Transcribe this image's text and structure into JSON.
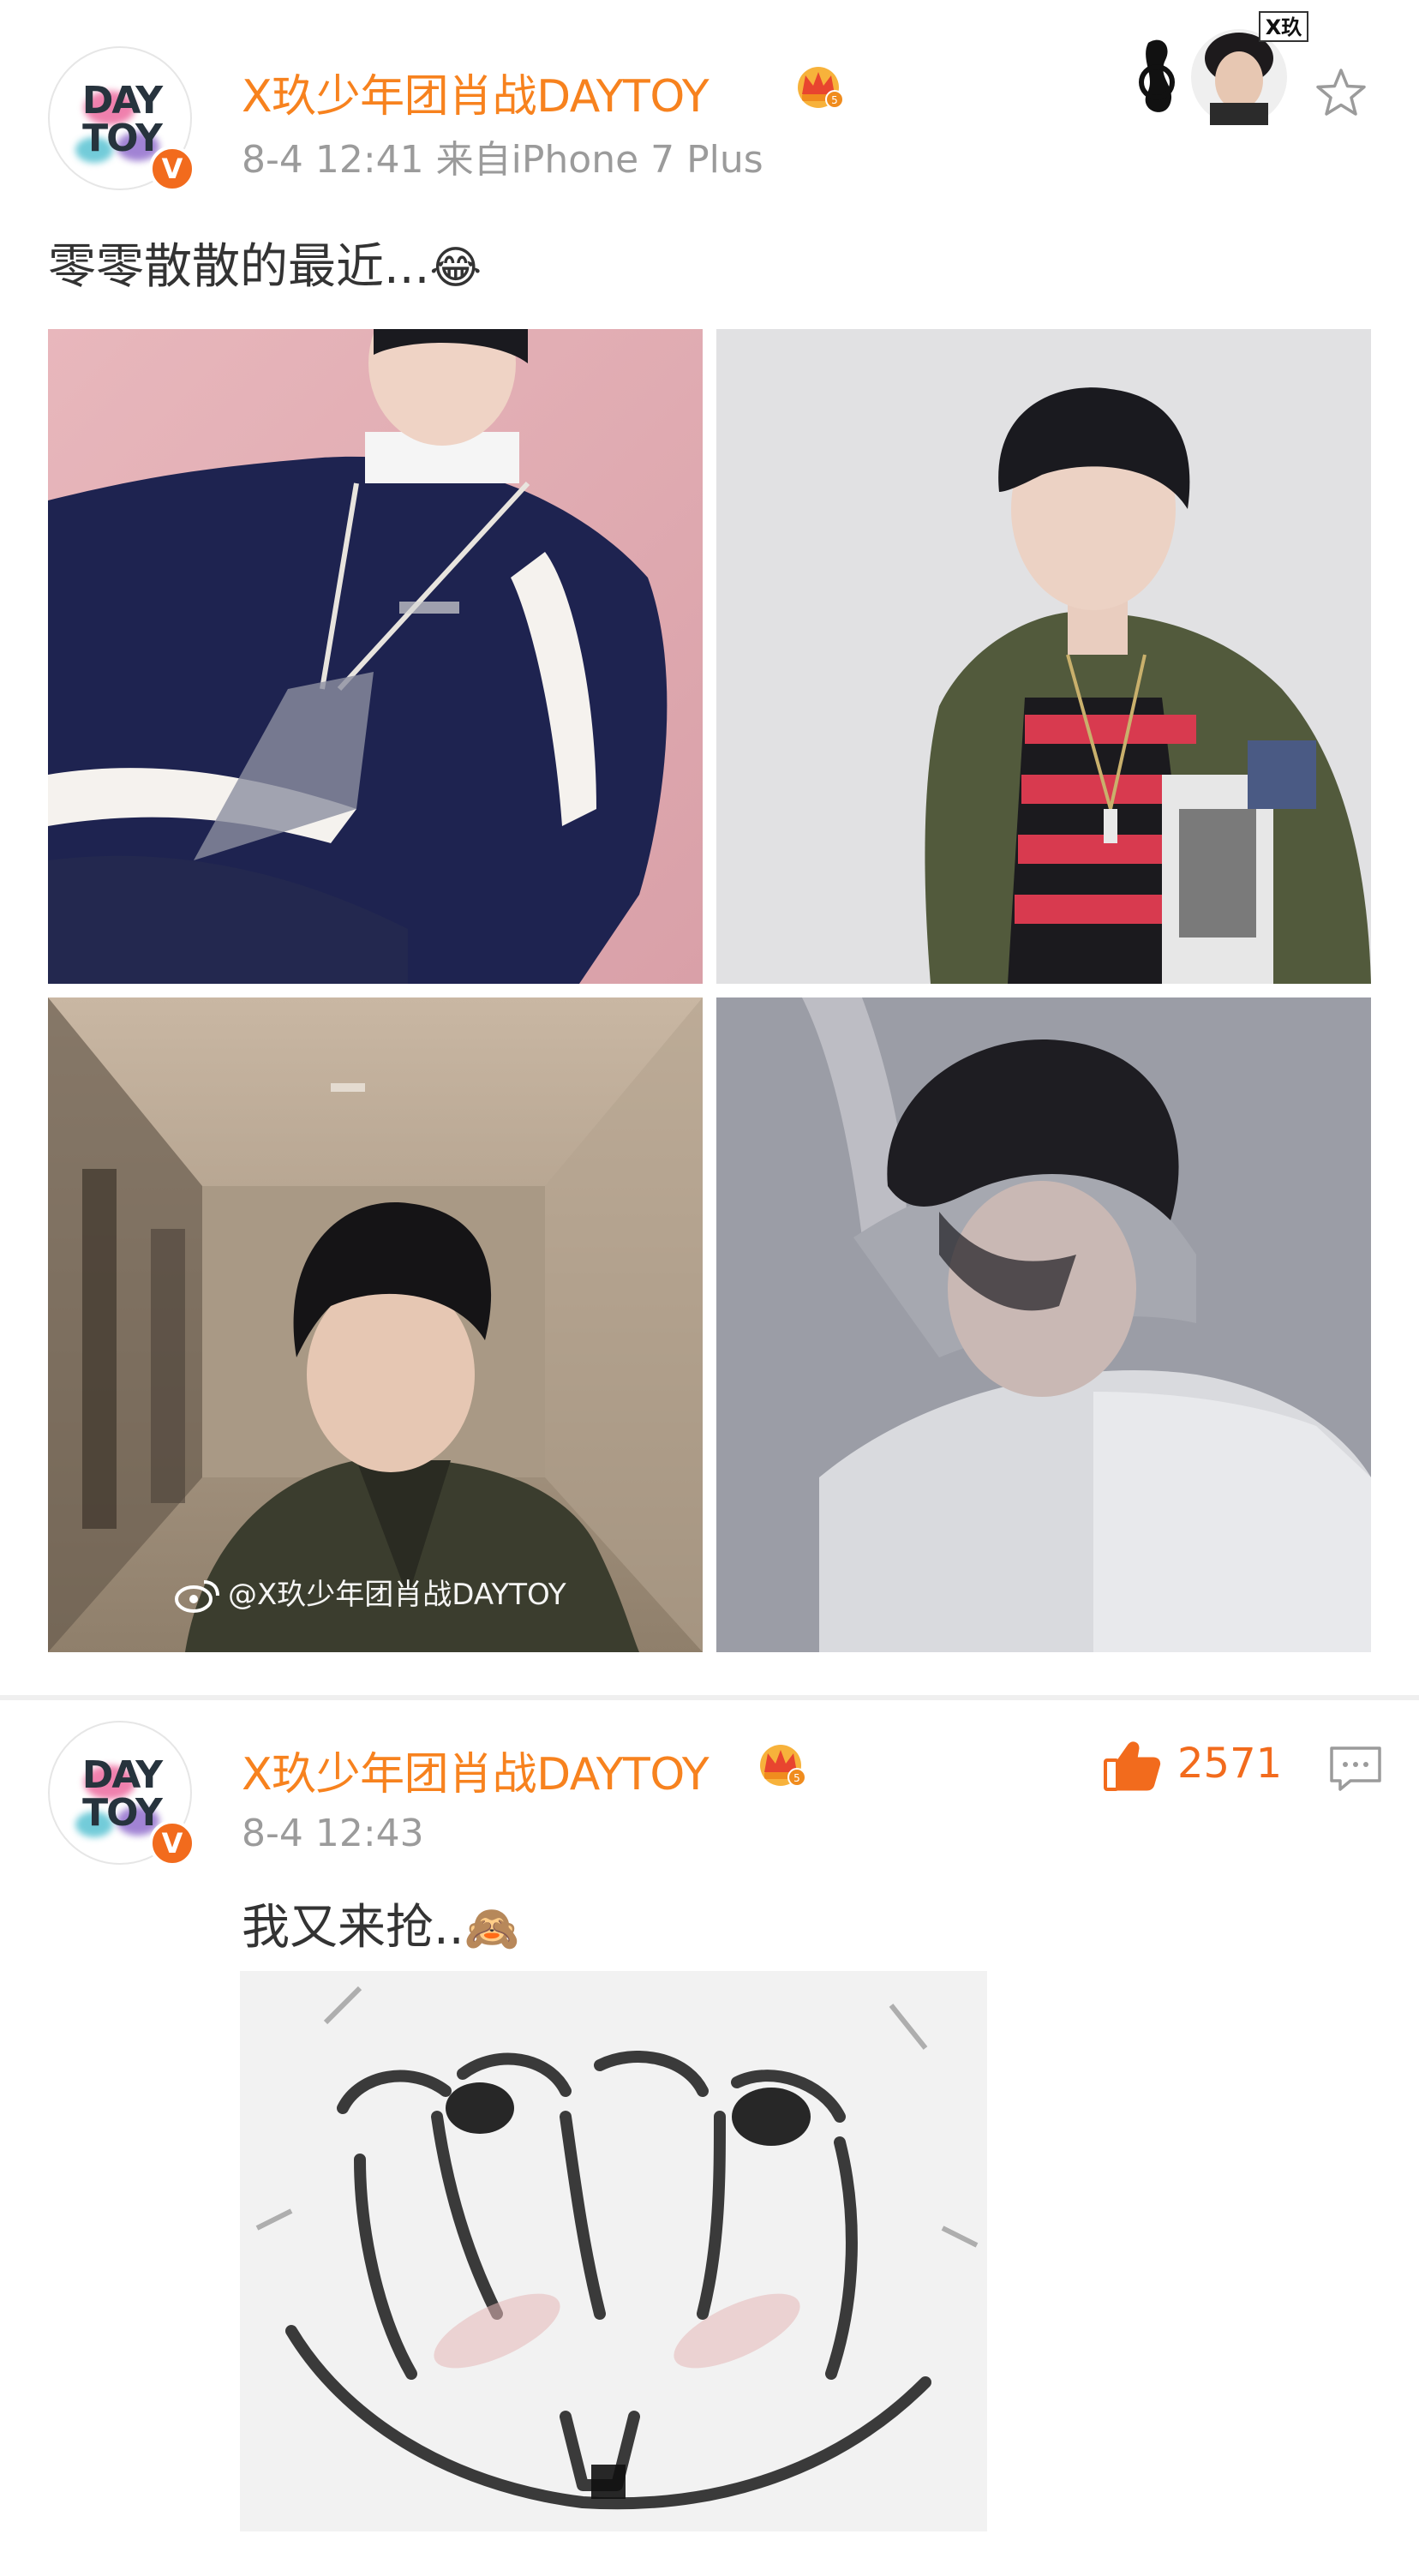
{
  "post": {
    "avatar": {
      "line1": "DAY",
      "line2": "TOY",
      "badge": "V"
    },
    "username": "X玖少年团肖战DAYTOY",
    "meta": "8-4 12:41  来自iPhone 7 Plus",
    "text": "零零散散的最近...",
    "text_emoji": "😂",
    "card_badge": "X玖",
    "photos": [
      {
        "name": "photo-navy-sweater"
      },
      {
        "name": "photo-olive-jacket-striped-shirt"
      },
      {
        "name": "photo-hallway-olive-jacket"
      },
      {
        "name": "photo-sleeping-white-shirt"
      }
    ],
    "watermark": "@X玖少年团肖战DAYTOY"
  },
  "comment": {
    "avatar": {
      "line1": "DAY",
      "line2": "TOY",
      "badge": "V"
    },
    "username": "X玖少年团肖战DAYTOY",
    "meta": "8-4 12:43",
    "text": "我又来抢..",
    "text_emoji": "🙈",
    "likes": "2571"
  },
  "colors": {
    "username": "#f7821e",
    "meta": "#9b9b9b",
    "like": "#f26b1d",
    "badge": "#f26b1d"
  },
  "icons": [
    "crown-icon",
    "star-icon",
    "thumbs-up-icon",
    "comment-icon",
    "verified-badge-icon",
    "weibo-logo-icon"
  ]
}
